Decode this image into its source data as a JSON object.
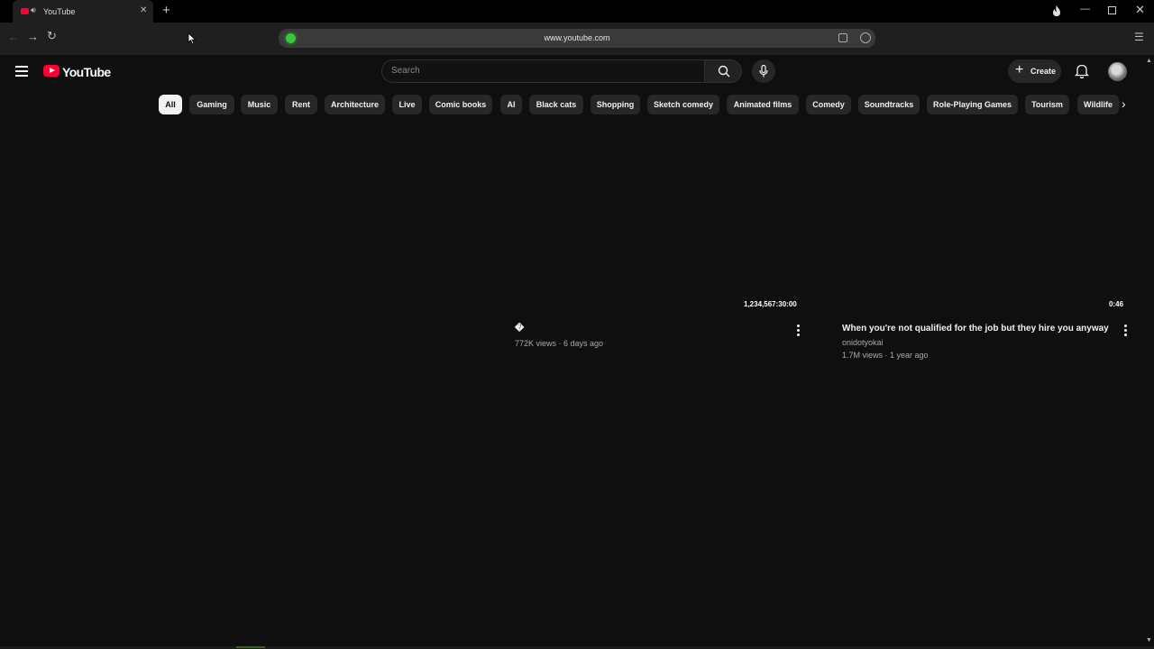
{
  "browser": {
    "tab_title": "YouTube",
    "url": "www.youtube.com"
  },
  "masthead": {
    "logo_text": "YouTube",
    "search_placeholder": "Search",
    "create_label": "Create"
  },
  "chips": [
    {
      "label": "All",
      "active": true
    },
    {
      "label": "Gaming"
    },
    {
      "label": "Music"
    },
    {
      "label": "Rent"
    },
    {
      "label": "Architecture"
    },
    {
      "label": "Live"
    },
    {
      "label": "Comic books"
    },
    {
      "label": "AI"
    },
    {
      "label": "Black cats"
    },
    {
      "label": "Shopping"
    },
    {
      "label": "Sketch comedy"
    },
    {
      "label": "Animated films"
    },
    {
      "label": "Comedy"
    },
    {
      "label": "Soundtracks"
    },
    {
      "label": "Role-Playing Games"
    },
    {
      "label": "Tourism"
    },
    {
      "label": "Wildlife"
    }
  ],
  "videos": [
    {
      "duration": "1,234,567:30:00",
      "title": "�",
      "channel": "",
      "meta": "772K views · 6 days ago"
    },
    {
      "duration": "0:46",
      "title": "When you're not qualified for the job but they hire you anyway",
      "channel": "onidotyokai",
      "meta": "1.7M views · 1 year ago"
    }
  ],
  "colors": {
    "accent_red": "#ff0033",
    "background": "#0f0f0f",
    "chip_bg": "#272727"
  }
}
